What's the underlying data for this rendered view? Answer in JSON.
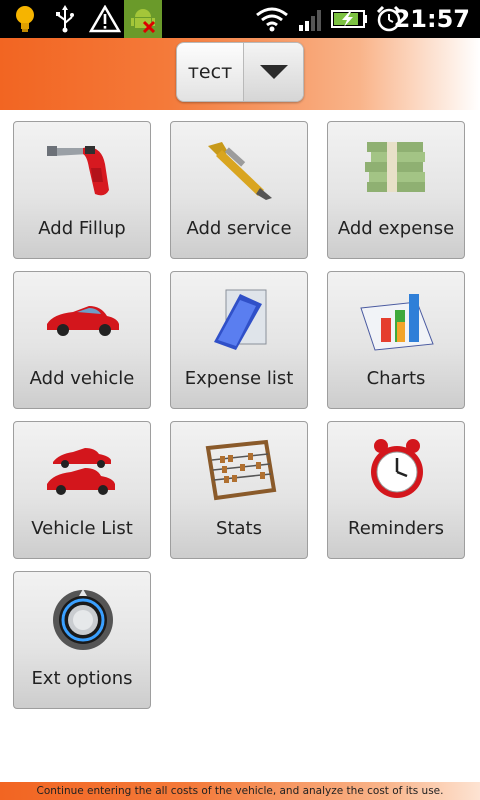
{
  "status_bar": {
    "time": "21:57",
    "icons": [
      "bulb-icon",
      "usb-icon",
      "warning-icon",
      "android-debug-icon",
      "wifi-icon",
      "signal-icon",
      "battery-charging-icon",
      "alarm-icon"
    ]
  },
  "header": {
    "vehicle_name": "тест",
    "dropdown_icon": "chevron-down-icon"
  },
  "tiles": [
    {
      "label": "Add Fillup",
      "icon": "fuel-nozzle-icon"
    },
    {
      "label": "Add service",
      "icon": "wrench-icon"
    },
    {
      "label": "Add expense",
      "icon": "money-stack-icon"
    },
    {
      "label": "Add vehicle",
      "icon": "red-car-icon"
    },
    {
      "label": "Expense list",
      "icon": "notepad-icon"
    },
    {
      "label": "Charts",
      "icon": "bar-chart-icon"
    },
    {
      "label": "Vehicle List",
      "icon": "two-cars-icon"
    },
    {
      "label": "Stats",
      "icon": "abacus-icon"
    },
    {
      "label": "Reminders",
      "icon": "alarm-clock-icon"
    },
    {
      "label": "Ext options",
      "icon": "power-knob-icon"
    }
  ],
  "footer": {
    "text": "Continue entering the all costs of the vehicle, and analyze the cost of its use."
  },
  "colors": {
    "accent": "#f26522",
    "status_bar": "#000000",
    "tile_border": "#9e9e9e"
  }
}
